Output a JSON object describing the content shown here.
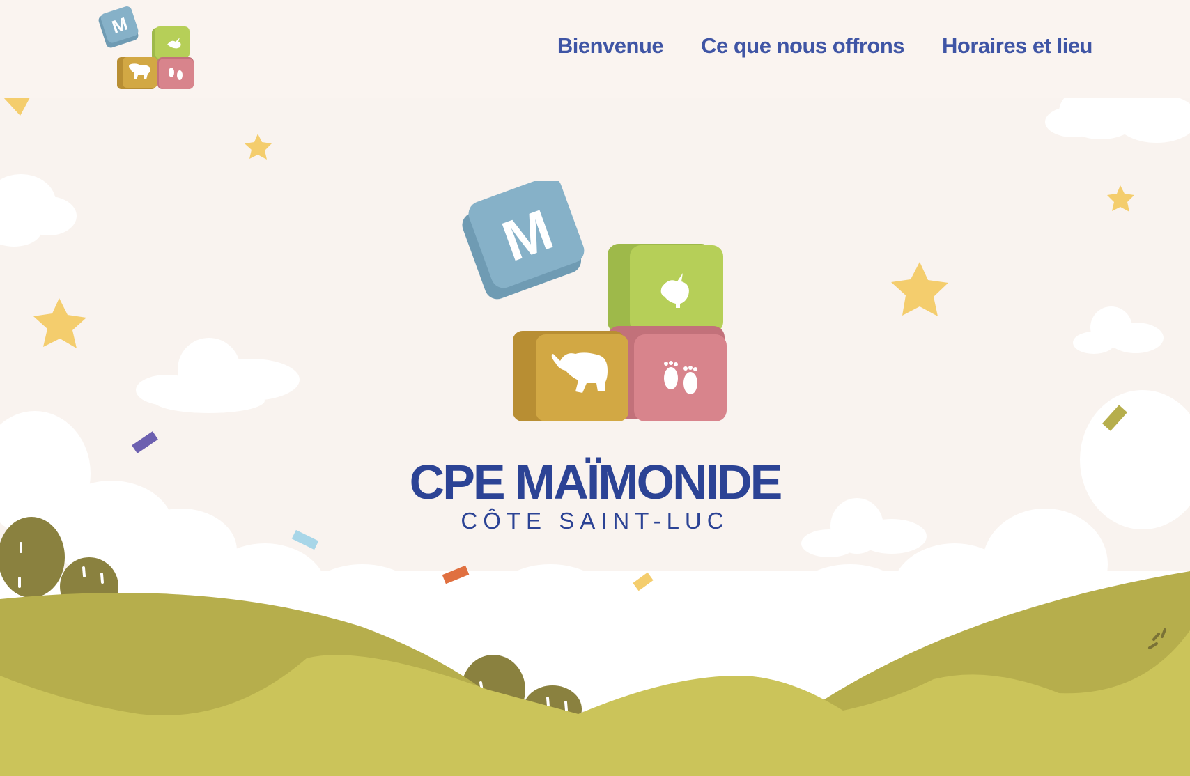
{
  "header": {
    "logo": {
      "icons": [
        "letter-m-block-icon",
        "rabbit-icon",
        "elephant-icon",
        "baby-feet-icon"
      ],
      "letter": "M"
    },
    "nav": [
      {
        "label": "Bienvenue"
      },
      {
        "label": "Ce que nous offrons"
      },
      {
        "label": "Horaires et lieu"
      }
    ]
  },
  "hero": {
    "logo": {
      "icons": [
        "letter-m-block-icon",
        "rabbit-icon",
        "elephant-icon",
        "baby-feet-icon"
      ],
      "letter": "M"
    },
    "title": "CPE MAÏMONIDE",
    "subtitle": "CÔTE SAINT-LUC"
  },
  "colors": {
    "background": "#f9f3ef",
    "brand_blue": "#2c4395",
    "nav_blue": "#3f55a5",
    "block_blue": "#86b1c8",
    "block_green": "#b6cf58",
    "block_orange": "#d2a844",
    "block_pink": "#d8848c",
    "hill_light": "#cbc45a",
    "hill_dark": "#b6ae4c",
    "bush": "#8a813f",
    "star": "#f4cd6d"
  }
}
